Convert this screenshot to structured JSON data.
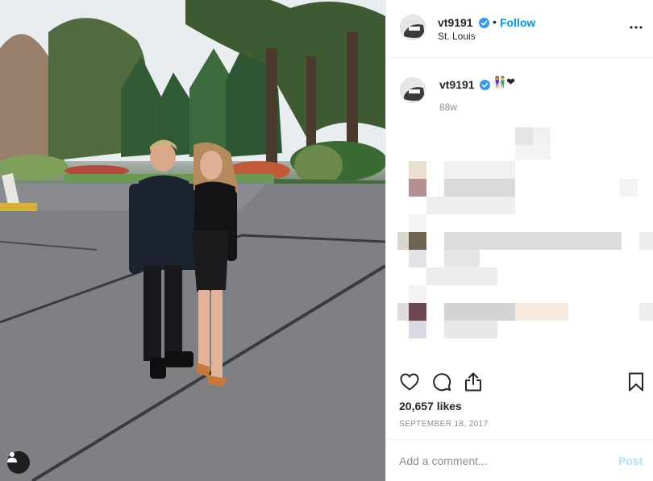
{
  "post": {
    "username": "vt9191",
    "location": "St. Louis",
    "follow_label": "Follow",
    "separator": "•"
  },
  "caption": {
    "username": "vt9191",
    "emoji": "👫❤",
    "time_ago": "88w"
  },
  "engagement": {
    "likes": "20,657 likes",
    "date": "SEPTEMBER 18, 2017"
  },
  "comment": {
    "placeholder": "Add a comment...",
    "post_label": "Post"
  },
  "icons": {
    "verified": "verified-badge-icon",
    "more": "more-options-icon",
    "like": "heart-icon",
    "comment": "comment-bubble-icon",
    "share": "share-icon",
    "save": "bookmark-icon",
    "user_tag": "user-tag-icon"
  },
  "colors": {
    "accent": "#0095f6",
    "post_disabled": "#b2dffc",
    "text": "#262626",
    "muted": "#8e8e8e",
    "divider": "#efefef"
  }
}
